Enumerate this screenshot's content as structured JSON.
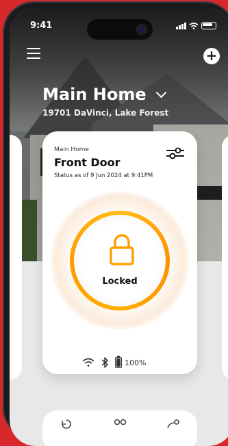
{
  "status_bar": {
    "time": "9:41"
  },
  "header": {
    "home_name": "Main Home",
    "address": "19701 DaVinci, Lake Forest",
    "add_label": "+"
  },
  "card": {
    "home_label": "Main Home",
    "device_name": "Front Door",
    "status_text": "Status as of 9 Jun 2024 at 9:41PM",
    "lock_state": "Locked",
    "battery": "100%"
  },
  "colors": {
    "brand_red": "#d7282b",
    "lock_orange": "#ff9a00"
  },
  "icons": {
    "menu": "hamburger-icon",
    "add": "plus-icon",
    "settings": "sliders-icon",
    "lock": "padlock-icon",
    "wifi": "wifi-icon",
    "bluetooth": "bluetooth-icon",
    "battery": "battery-icon"
  }
}
